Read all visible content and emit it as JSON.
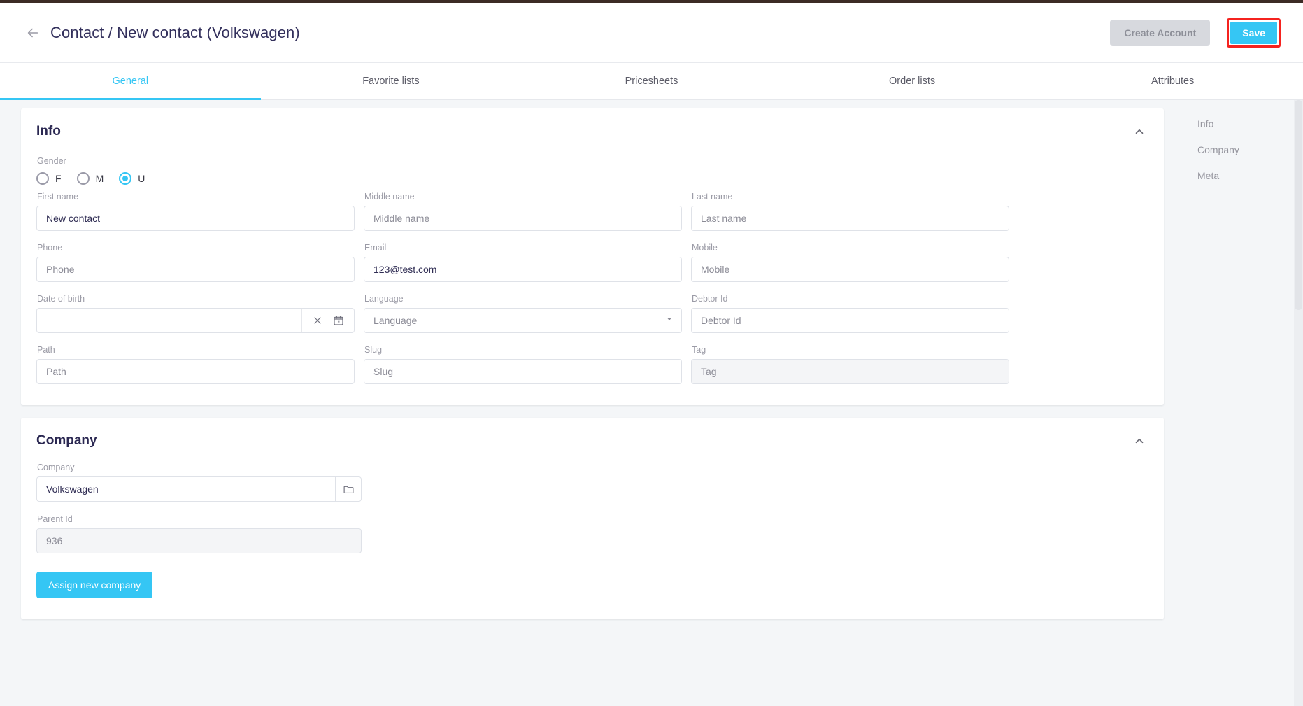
{
  "header": {
    "back_icon": "arrow-left-icon",
    "title": "Contact / New contact (Volkswagen)",
    "create_account_label": "Create Account",
    "save_label": "Save",
    "save_highlight_color": "#f5231f",
    "accent_color": "#35c6f4"
  },
  "tabs": [
    {
      "label": "General",
      "active": true
    },
    {
      "label": "Favorite lists",
      "active": false
    },
    {
      "label": "Pricesheets",
      "active": false
    },
    {
      "label": "Order lists",
      "active": false
    },
    {
      "label": "Attributes",
      "active": false
    }
  ],
  "info_section": {
    "title": "Info",
    "collapse_icon": "chevron-up-icon",
    "gender": {
      "label": "Gender",
      "options": [
        {
          "label": "F",
          "checked": false
        },
        {
          "label": "M",
          "checked": false
        },
        {
          "label": "U",
          "checked": true
        }
      ]
    },
    "fields": {
      "first_name": {
        "label": "First name",
        "value": "New contact",
        "placeholder": "First name"
      },
      "middle_name": {
        "label": "Middle name",
        "value": "",
        "placeholder": "Middle name"
      },
      "last_name": {
        "label": "Last name",
        "value": "",
        "placeholder": "Last name"
      },
      "phone": {
        "label": "Phone",
        "value": "",
        "placeholder": "Phone"
      },
      "email": {
        "label": "Email",
        "value": "123@test.com",
        "placeholder": "Email"
      },
      "mobile": {
        "label": "Mobile",
        "value": "",
        "placeholder": "Mobile"
      },
      "date_of_birth": {
        "label": "Date of birth",
        "value": "",
        "placeholder": "",
        "clear_icon": "close-icon",
        "calendar_icon": "calendar-icon"
      },
      "language": {
        "label": "Language",
        "value": "",
        "placeholder": "Language",
        "caret_icon": "chevron-down-icon"
      },
      "debtor_id": {
        "label": "Debtor Id",
        "value": "",
        "placeholder": "Debtor Id"
      },
      "path": {
        "label": "Path",
        "value": "",
        "placeholder": "Path"
      },
      "slug": {
        "label": "Slug",
        "value": "",
        "placeholder": "Slug"
      },
      "tag": {
        "label": "Tag",
        "value": "",
        "placeholder": "Tag",
        "disabled": true
      }
    }
  },
  "company_section": {
    "title": "Company",
    "collapse_icon": "chevron-up-icon",
    "company": {
      "label": "Company",
      "value": "Volkswagen",
      "placeholder": "Company",
      "picker_icon": "folder-icon"
    },
    "parent_id": {
      "label": "Parent Id",
      "value": "936",
      "placeholder": "Parent Id",
      "disabled": true
    },
    "assign_button_label": "Assign new company"
  },
  "rail": {
    "items": [
      {
        "label": "Info"
      },
      {
        "label": "Company"
      },
      {
        "label": "Meta"
      }
    ]
  }
}
